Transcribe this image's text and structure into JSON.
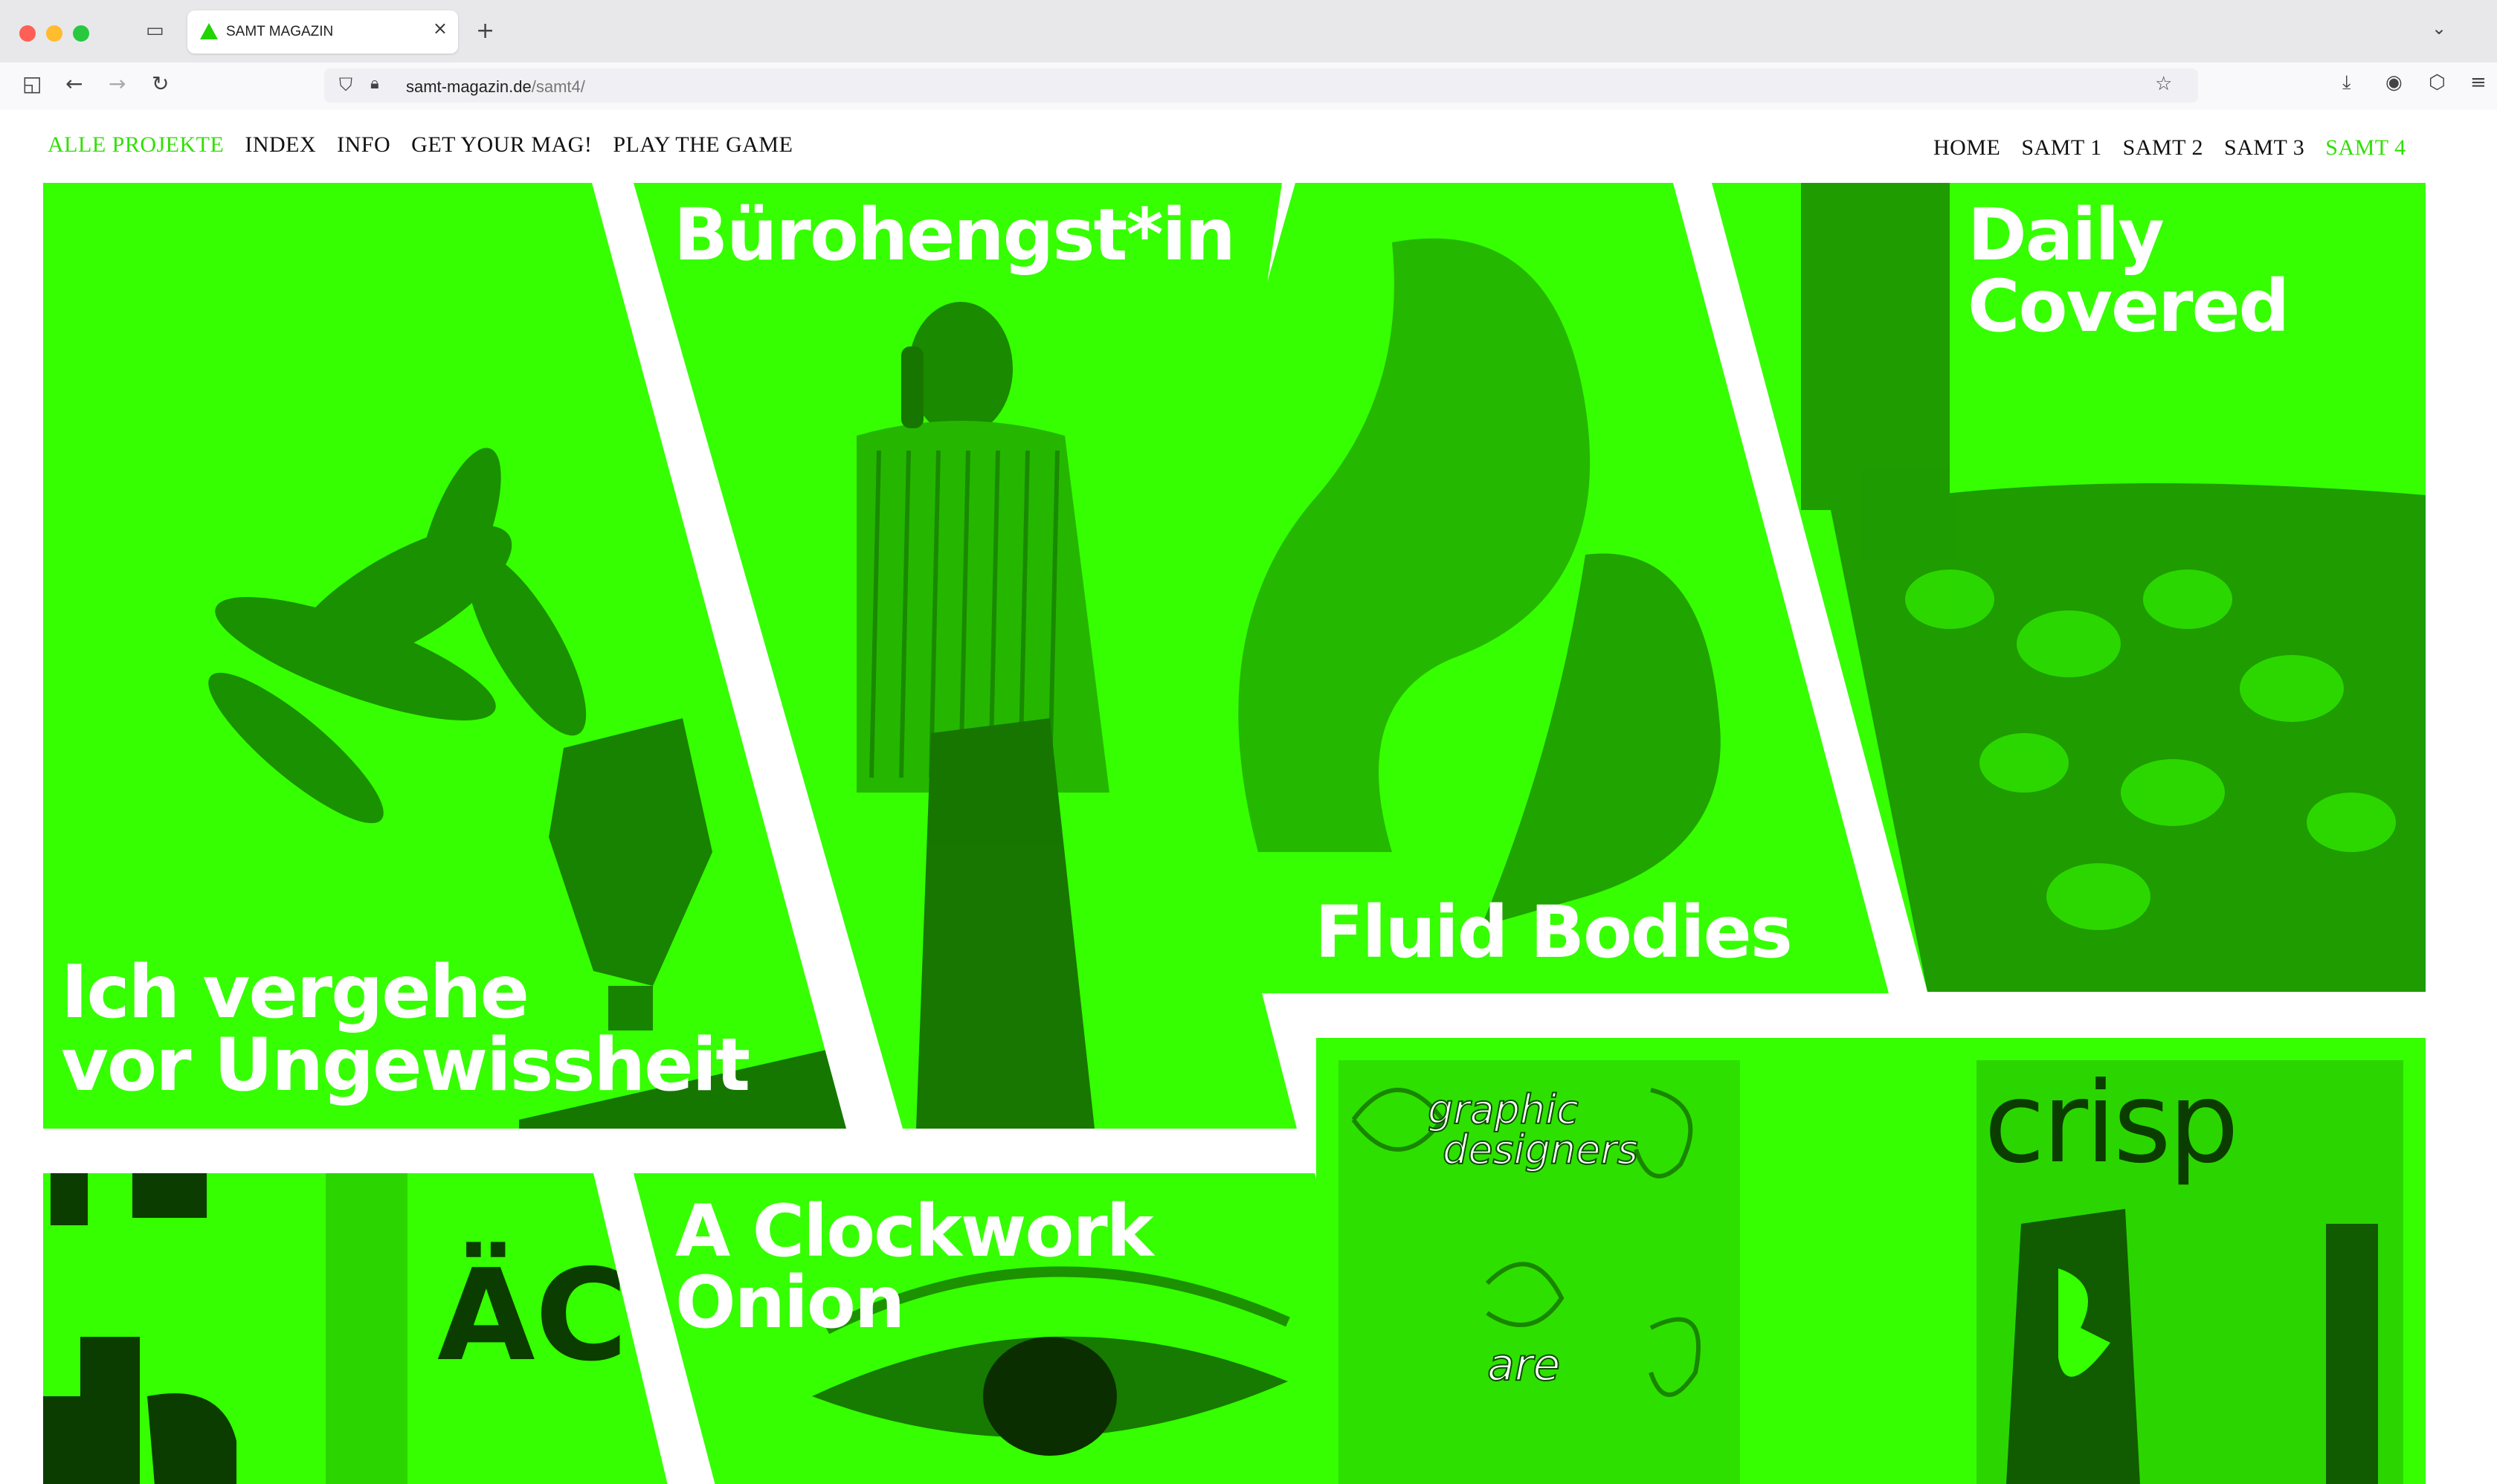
{
  "browser": {
    "tab_title": "SAMT MAGAZIN",
    "url_domain": "samt-magazin.de",
    "url_path": "/samt4/"
  },
  "nav_left": [
    "ALLE PROJEKTE",
    "INDEX",
    "INFO",
    "GET YOUR MAG!",
    "PLAY THE GAME"
  ],
  "nav_right": [
    "HOME",
    "SAMT 1",
    "SAMT 2",
    "SAMT 3",
    "SAMT 4"
  ],
  "tiles": {
    "ungewissheit": "Ich vergehe\nvor Ungewissheit",
    "buerohengst": "Bürohengst*in",
    "fluid": "Fluid Bodies",
    "daily": "Daily Covered",
    "clockwork": "A Clockwork\n Onion",
    "poster_words": [
      "graphic",
      "designers",
      "are",
      "crisp"
    ]
  },
  "colors": {
    "accent": "#35ff00",
    "active_link": "#2fe000"
  }
}
